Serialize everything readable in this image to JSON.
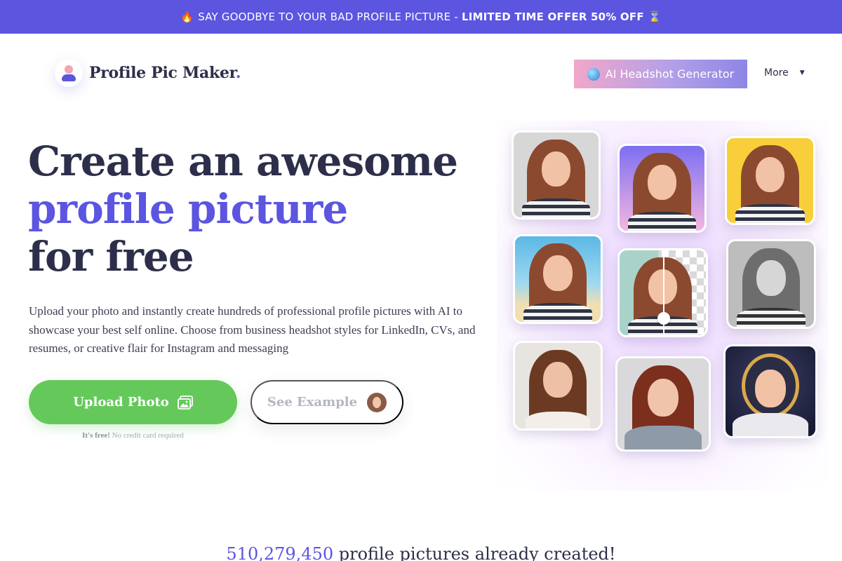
{
  "promo": {
    "fire_emoji": "🔥",
    "text": "SAY GOODBYE TO YOUR BAD PROFILE PICTURE -",
    "offer": "LIMITED TIME OFFER 50% OFF",
    "hourglass_emoji": "⌛"
  },
  "header": {
    "logo_text": "Profile Pic Maker",
    "logo_dot": ".",
    "ai_button_label": "AI Headshot Generator",
    "more_label": "More"
  },
  "hero": {
    "headline_line1": "Create an awesome",
    "headline_accent": "profile picture",
    "headline_line3": "for free",
    "description": "Upload your photo and instantly create hundreds of professional profile pictures with AI to showcase your best self online. Choose from business headshot styles for LinkedIn, CVs, and resumes, or creative flair for Instagram and messaging",
    "upload_label": "Upload Photo",
    "example_label": "See Example",
    "free_strong": "It's free!",
    "free_note": "No credit card required"
  },
  "stats": {
    "count": "510,279,450",
    "text": "profile pictures already created!"
  },
  "colors": {
    "brand": "#5b55e0",
    "upload_green": "#64c95a",
    "heading": "#2d2f4a"
  }
}
